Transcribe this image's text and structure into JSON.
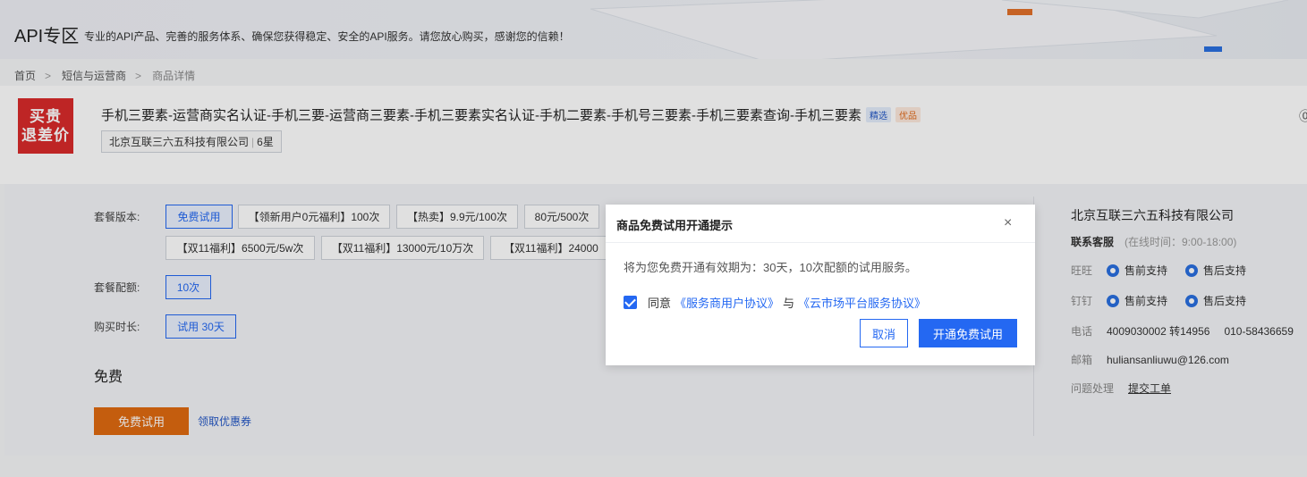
{
  "banner": {
    "title": "API专区",
    "subtitle": "专业的API产品、完善的服务体系、确保您获得稳定、安全的API服务。请您放心购买，感谢您的信赖！"
  },
  "breadcrumb": {
    "home": "首页",
    "category": "短信与运营商",
    "current": "商品详情",
    "sep": ">"
  },
  "product": {
    "logo_line1": "买贵",
    "logo_line2": "退差价",
    "title": "手机三要素-运营商实名认证-手机三要-运营商三要素-手机三要素实名认证-手机二要素-手机号三要素-手机三要素查询-手机三要素",
    "tag_featured": "精选",
    "tag_quality": "优品",
    "vendor": "北京互联三六五科技有限公司",
    "rating": "6星",
    "edge_icon": "⓪"
  },
  "plan": {
    "version_label": "套餐版本:",
    "versions": [
      "免费试用",
      "【领新用户0元福利】100次",
      "【热卖】9.9元/100次",
      "80元/500次",
      "【双11福利】6500元/5w次",
      "【双11福利】13000元/10万次",
      "【双11福利】24000"
    ],
    "quota_label": "套餐配额:",
    "quota": "10次",
    "duration_label": "购买时长:",
    "duration": "试用 30天",
    "price": "免费",
    "try_button": "免费试用",
    "coupon_link": "领取优惠券"
  },
  "sidebar": {
    "company": "北京互联三六五科技有限公司",
    "service_label": "联系客服",
    "service_hours": "(在线时间：9:00-18:00)",
    "wangwang_label": "旺旺",
    "dingding_label": "钉钉",
    "presale": "售前支持",
    "aftersale": "售后支持",
    "phone_label": "电话",
    "phone1": "4009030002 转14956",
    "phone2": "010-58436659",
    "email_label": "邮箱",
    "email": "huliansanliuwu@126.com",
    "issue_label": "问题处理",
    "issue_link": "提交工单"
  },
  "modal": {
    "title": "商品免费试用开通提示",
    "close": "×",
    "message": "将为您免费开通有效期为：30天，10次配额的试用服务。",
    "agree": "同意",
    "agreement1": "《服务商用户协议》",
    "and": "与",
    "agreement2": "《云市场平台服务协议》",
    "cancel": "取消",
    "confirm": "开通免费试用"
  },
  "colors": {
    "accent": "#2468f2",
    "orange": "#e06a10",
    "logo_red": "#d92b2b"
  }
}
